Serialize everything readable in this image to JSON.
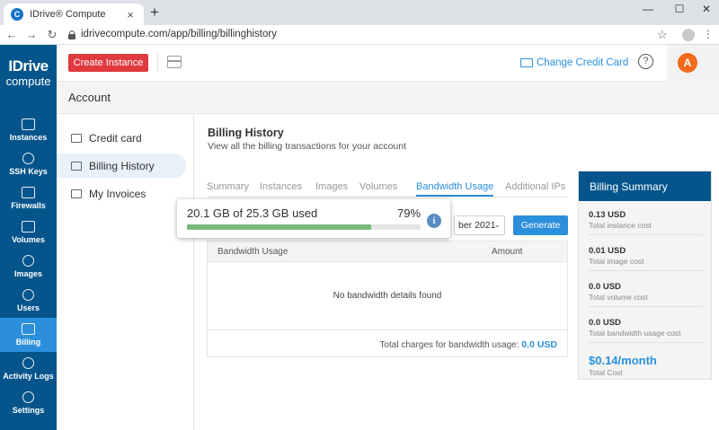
{
  "browser": {
    "tab_title": "IDrive® Compute",
    "favicon_letter": "C",
    "url": "idrivecompute.com/app/billing/billinghistory"
  },
  "sidebar": {
    "logo_top": "IDrive",
    "logo_bottom": "compute",
    "items": [
      {
        "label": "Instances",
        "icon": "instances-icon"
      },
      {
        "label": "SSH Keys",
        "icon": "key-icon"
      },
      {
        "label": "Firewalls",
        "icon": "firewall-icon"
      },
      {
        "label": "Volumes",
        "icon": "volumes-icon"
      },
      {
        "label": "Images",
        "icon": "images-icon"
      },
      {
        "label": "Users",
        "icon": "users-icon"
      },
      {
        "label": "Billing",
        "icon": "billing-icon"
      },
      {
        "label": "Activity Logs",
        "icon": "activity-logs-icon"
      },
      {
        "label": "Settings",
        "icon": "gear-icon"
      }
    ],
    "active": "Billing"
  },
  "topbar": {
    "create_label": "Create Instance",
    "change_card_label": "Change Credit Card",
    "help_glyph": "?",
    "avatar_letter": "A"
  },
  "account": {
    "title": "Account",
    "nav": [
      {
        "label": "Credit card"
      },
      {
        "label": "Billing History"
      },
      {
        "label": "My Invoices"
      }
    ],
    "active": "Billing History"
  },
  "billing": {
    "title": "Billing History",
    "subtitle": "View all the billing transactions for your account",
    "tabs": [
      "Summary",
      "Instances",
      "Images",
      "Volumes",
      "Bandwidth Usage",
      "Additional IPs"
    ],
    "active_tab": "Bandwidth Usage",
    "date_value": "ber 2021",
    "generate_label": "Generate",
    "table": {
      "col1": "Bandwidth Usage",
      "col2": "Amount",
      "empty": "No bandwidth details found",
      "total_label": "Total charges for bandwidth usage:",
      "total_value": "0.0 USD"
    }
  },
  "summary": {
    "title": "Billing Summary",
    "rows": [
      {
        "value": "0.13 USD",
        "label": "Total instance cost"
      },
      {
        "value": "0.01 USD",
        "label": "Total image cost"
      },
      {
        "value": "0.0 USD",
        "label": "Total volume cost"
      },
      {
        "value": "0.0 USD",
        "label": "Total bandwidth usage cost"
      }
    ],
    "total_value": "$0.14/month",
    "total_label": "Total Cost"
  },
  "storage_popup": {
    "text": "20.1 GB of 25.3 GB used",
    "percent_text": "79%",
    "percent": 79,
    "info_glyph": "i"
  },
  "colors": {
    "sidebar": "#05558c",
    "accent": "#2b8fdb",
    "create_button": "#e0393e",
    "avatar": "#f26b1d",
    "progress": "#7ab87a"
  }
}
